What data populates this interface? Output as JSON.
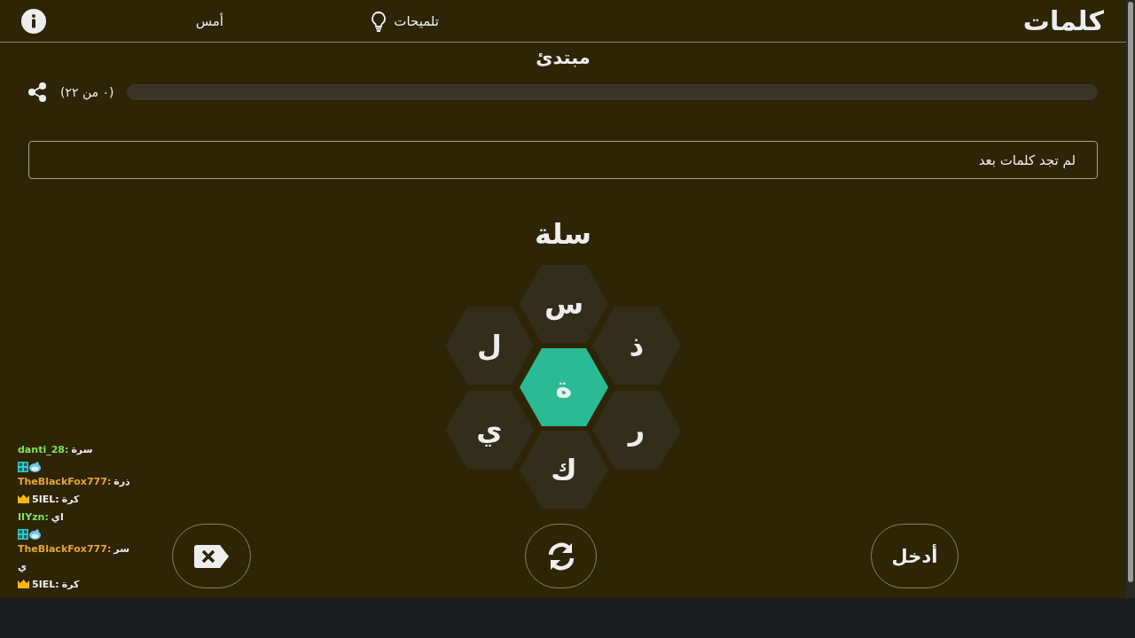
{
  "header": {
    "logo": "كلمات",
    "hints": "تلميحات",
    "yesterday": "أمس"
  },
  "level_title": "مبتدئ",
  "progress": {
    "counter": "(٠ من ٢٢)",
    "level": 0
  },
  "found_words": {
    "placeholder": "لم تجد كلمات بعد"
  },
  "current_word": "سلة",
  "letters": [
    {
      "letter": "س",
      "selected": false
    },
    {
      "letter": "ل",
      "selected": false
    },
    {
      "letter": "ذ",
      "selected": false
    },
    {
      "letter": "ة",
      "selected": true
    },
    {
      "letter": "ي",
      "selected": false
    },
    {
      "letter": "ر",
      "selected": false
    },
    {
      "letter": "ك",
      "selected": false
    }
  ],
  "buttons": {
    "enter": "أدخل"
  },
  "chat": [
    {
      "kind": "message",
      "user": "danti_28:",
      "text": "سرة",
      "color": "#7fe25a"
    },
    {
      "kind": "emotes"
    },
    {
      "kind": "message",
      "user": "TheBlackFox777:",
      "text": "ذرة",
      "color": "#e8a531"
    },
    {
      "kind": "crowned",
      "user": "5IEL:",
      "text": "كرة",
      "color": "#f0f0f0"
    },
    {
      "kind": "message",
      "user": "IIYzn:",
      "text": "اي",
      "color": "#7fe25a"
    },
    {
      "kind": "emotes"
    },
    {
      "kind": "message",
      "user": "TheBlackFox777:",
      "text": "سر",
      "color": "#e8a531"
    },
    {
      "kind": "continuation",
      "text": "ي"
    },
    {
      "kind": "crowned",
      "user": "5IEL:",
      "text": "كرة",
      "color": "#f0f0f0"
    }
  ]
}
